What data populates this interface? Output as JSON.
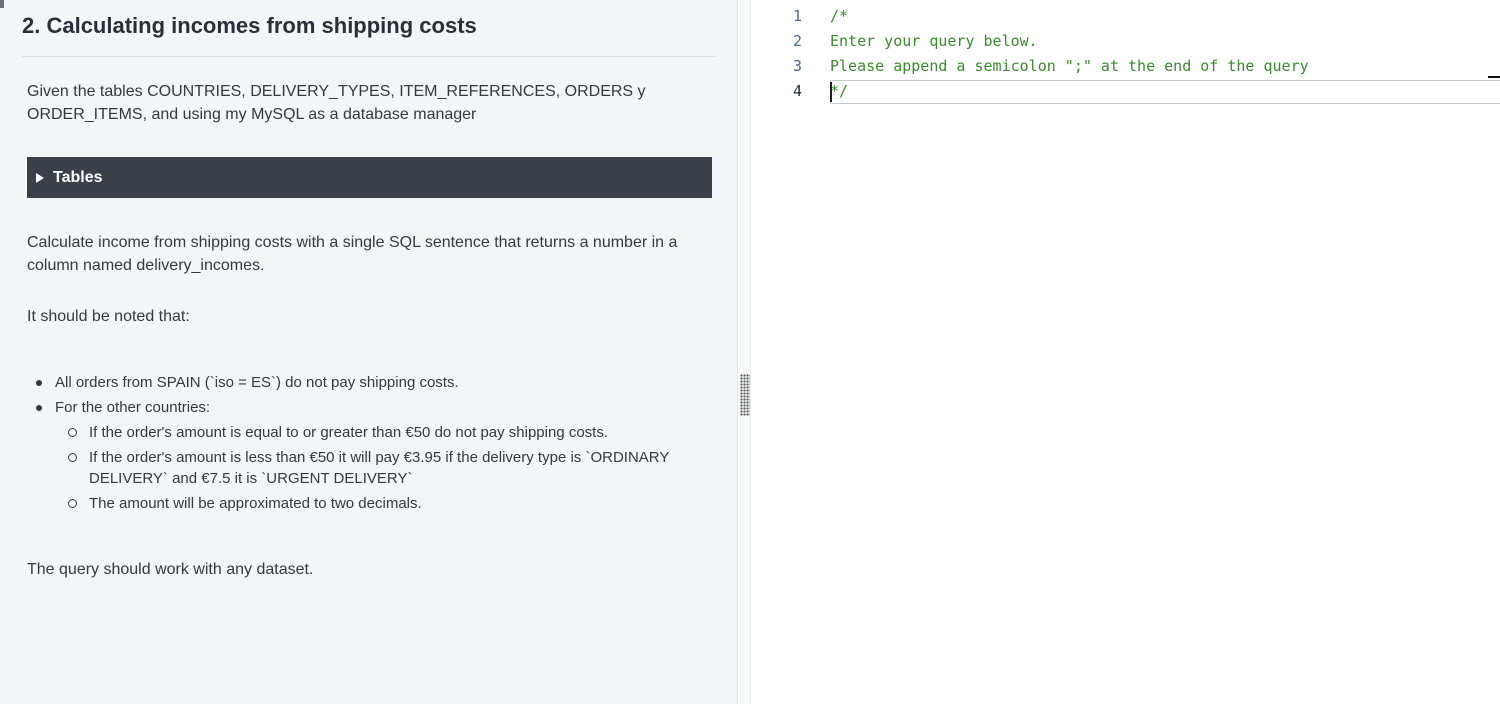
{
  "problem": {
    "title": "2. Calculating incomes from shipping costs",
    "given": "Given the tables COUNTRIES, DELIVERY_TYPES, ITEM_REFERENCES, ORDERS y ORDER_ITEMS, and using my MySQL as a database manager",
    "tables_label": "Tables",
    "calculate": "Calculate income from shipping costs with a single SQL sentence that returns a number in a column named delivery_incomes.",
    "noted": "It should be noted that:",
    "rules": [
      "All orders from SPAIN (`iso = ES`) do not pay shipping costs.",
      "For the other countries:"
    ],
    "sub_rules": [
      "If the order's amount is equal to or greater than €50 do not pay shipping costs.",
      "If the order's amount is less than €50 it will pay €3.95 if the delivery type is `ORDINARY DELIVERY` and €7.5 it is `URGENT DELIVERY`",
      "The amount will be approximated to two decimals."
    ],
    "footer": "The query should work with any dataset."
  },
  "editor": {
    "lines": [
      {
        "number": "1",
        "text": "/*"
      },
      {
        "number": "2",
        "text": "Enter your query below."
      },
      {
        "number": "3",
        "text": "Please append a semicolon \";\" at the end of the query"
      },
      {
        "number": "4",
        "text": "*/"
      }
    ],
    "comment_color": "#3b8a2f"
  }
}
